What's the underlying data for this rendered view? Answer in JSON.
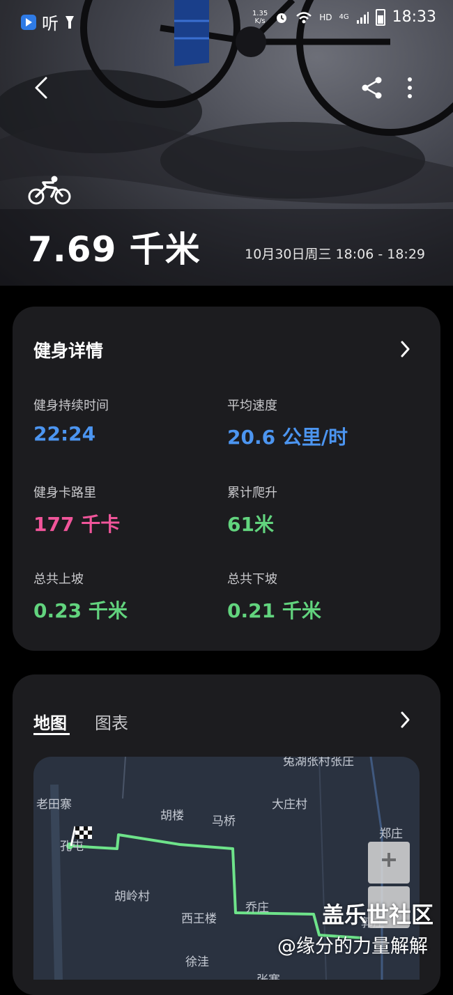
{
  "status_bar": {
    "app_name": "听",
    "net_speed_value": "1.35",
    "net_speed_unit": "K/s",
    "hd_label": "HD",
    "network_type": "4G",
    "time": "18:33"
  },
  "hero": {
    "distance": "7.69 千米",
    "date_range": "10月30日周三 18:06 - 18:29",
    "icons": [
      "back-icon",
      "share-icon",
      "more-icon",
      "bicycle-icon"
    ]
  },
  "details": {
    "title": "健身详情",
    "stats": [
      {
        "label": "健身持续时间",
        "value": "22:24",
        "color": "#4c95f0"
      },
      {
        "label": "平均速度",
        "value": "20.6 公里/时",
        "color": "#4c95f0"
      },
      {
        "label": "健身卡路里",
        "value": "177 千卡",
        "color": "#f0559a"
      },
      {
        "label": "累计爬升",
        "value": "61米",
        "color": "#62d47e"
      },
      {
        "label": "总共上坡",
        "value": "0.23 千米",
        "color": "#62d47e"
      },
      {
        "label": "总共下坡",
        "value": "0.21 千米",
        "color": "#62d47e"
      }
    ]
  },
  "map_section": {
    "tabs": [
      {
        "label": "地图",
        "active": true
      },
      {
        "label": "图表",
        "active": false
      }
    ],
    "place_labels": [
      "老田寨",
      "胡楼",
      "马桥",
      "大庄村",
      "郑庄",
      "胡岭村",
      "西王楼",
      "乔庄",
      "徐洼",
      "张寨",
      "兔湖张村张庄",
      "孔屯",
      "郭庄"
    ],
    "route_color": "#6ee38a",
    "zoom_in": "+"
  },
  "watermark": {
    "line1": "盖乐世社区",
    "line2": "@缘分的力量解解"
  }
}
